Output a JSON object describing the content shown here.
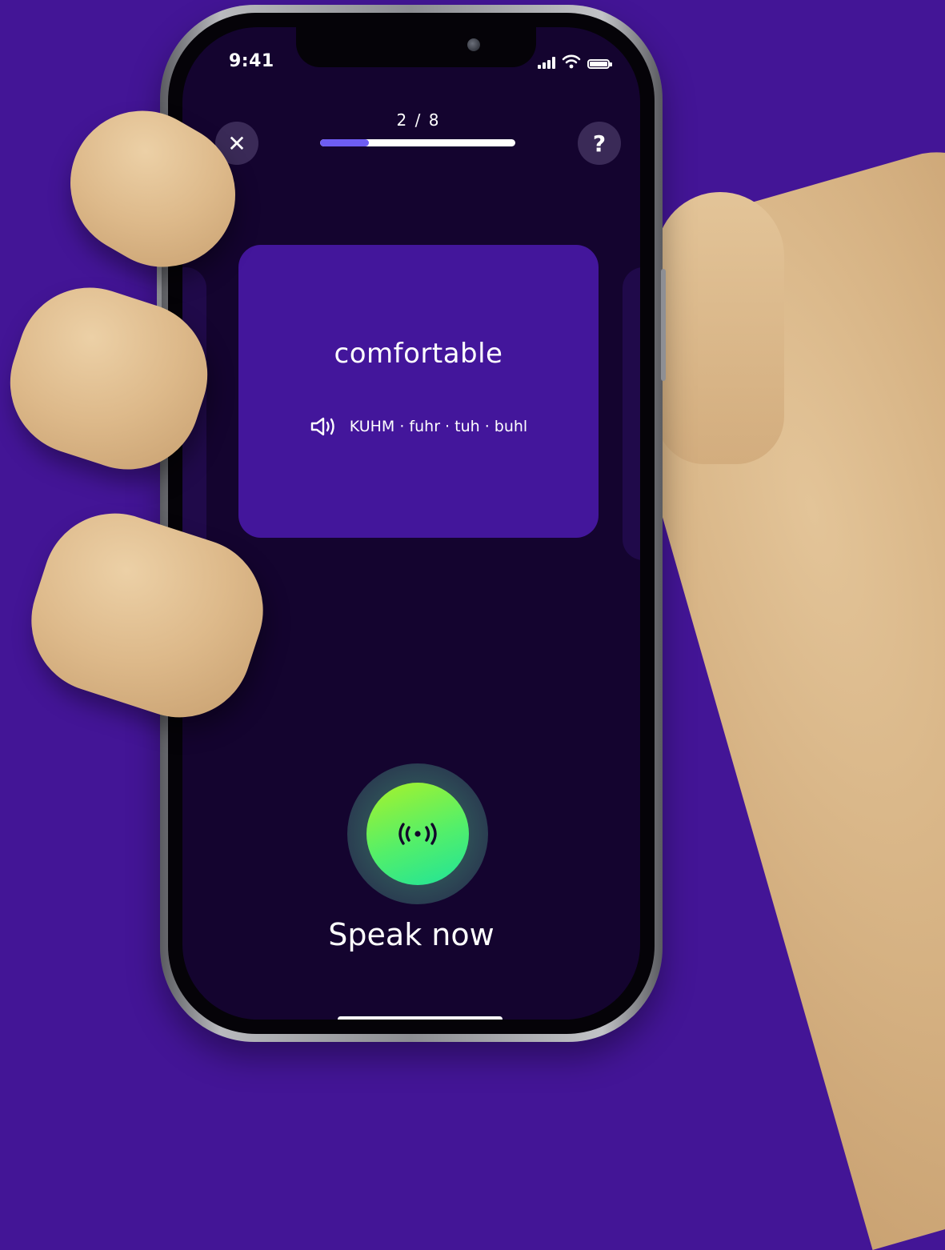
{
  "status_bar": {
    "time": "9:41"
  },
  "progress": {
    "label": "2 / 8",
    "current": 2,
    "total": 8,
    "fraction": 0.25
  },
  "buttons": {
    "close_label": "✕",
    "help_label": "?"
  },
  "card": {
    "word": "comfortable",
    "pronunciation": "KUHM · fuhr · tuh · buhl"
  },
  "mic": {
    "prompt": "Speak now"
  },
  "colors": {
    "background": "#431596",
    "screen": "#14042f",
    "card": "#43169b",
    "progress_fill": "#6e5df2",
    "mic_green": "#53ef6a"
  },
  "icons": {
    "close": "close-icon",
    "help": "question-icon",
    "speaker": "speaker-icon",
    "mic": "broadcast-icon",
    "signal": "signal-icon",
    "wifi": "wifi-icon",
    "battery": "battery-icon"
  }
}
